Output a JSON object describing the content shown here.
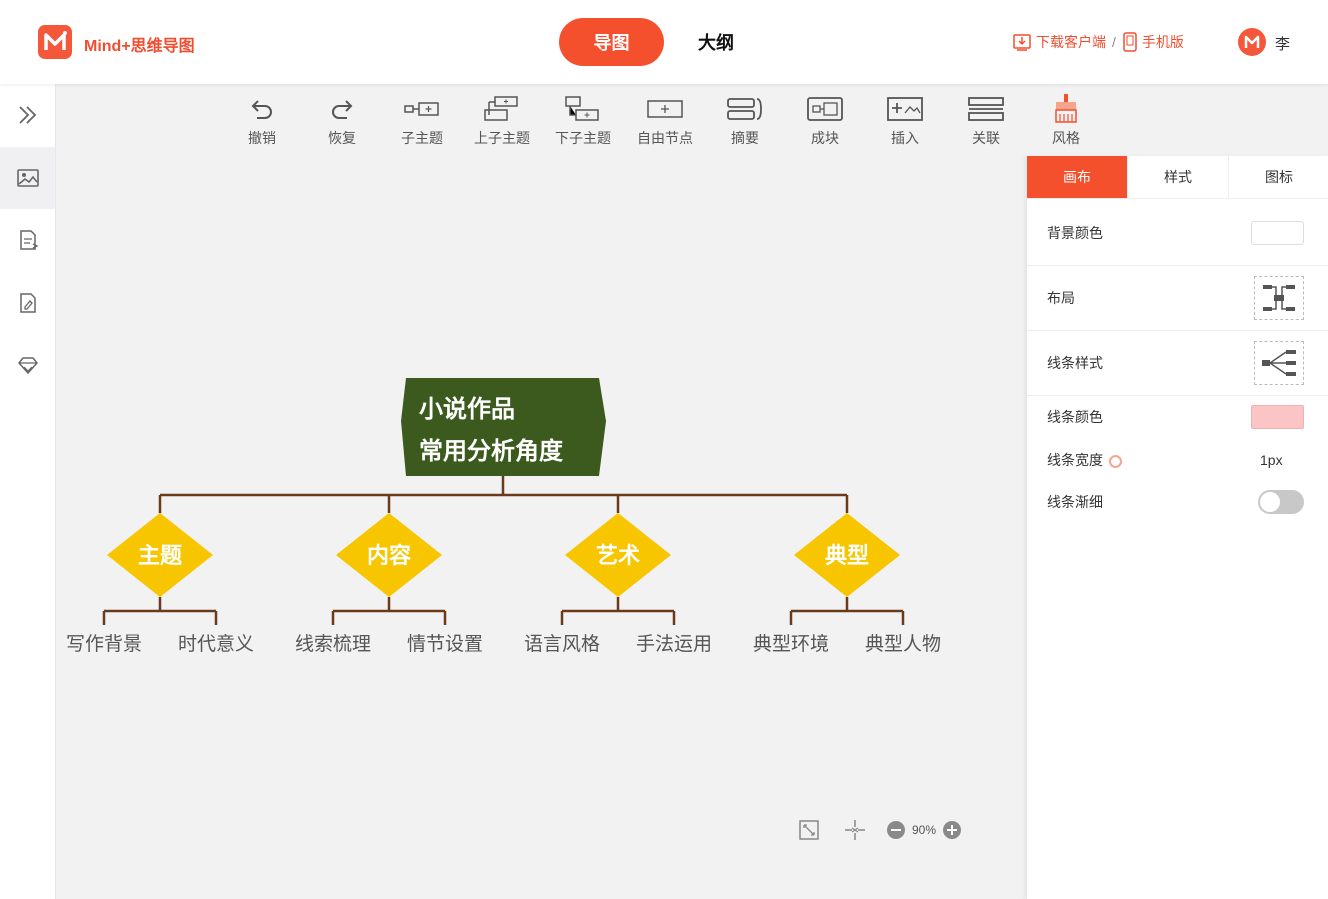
{
  "header": {
    "brand": "Mind+思维导图",
    "tabs": [
      {
        "label": "导图",
        "active": true
      },
      {
        "label": "大纲",
        "active": false
      }
    ],
    "download_client": "下载客户端",
    "separator": "/",
    "mobile": "手机版",
    "user": "李",
    "accent_color": "#f5502e"
  },
  "sidebar": {
    "items": [
      {
        "icon": "expand-chevrons-icon"
      },
      {
        "icon": "image-icon",
        "active": true
      },
      {
        "icon": "pdf-export-icon"
      },
      {
        "icon": "file-edit-icon"
      },
      {
        "icon": "diamond-icon"
      }
    ]
  },
  "toolbar": {
    "items": [
      {
        "label": "撤销",
        "icon": "undo-icon"
      },
      {
        "label": "恢复",
        "icon": "redo-icon"
      },
      {
        "label": "子主题",
        "icon": "child-topic-icon"
      },
      {
        "label": "上子主题",
        "icon": "upper-subtopic-icon"
      },
      {
        "label": "下子主题",
        "icon": "lower-subtopic-icon"
      },
      {
        "label": "自由节点",
        "icon": "free-node-icon"
      },
      {
        "label": "摘要",
        "icon": "summary-icon"
      },
      {
        "label": "成块",
        "icon": "block-icon"
      },
      {
        "label": "插入",
        "icon": "insert-icon"
      },
      {
        "label": "关联",
        "icon": "relation-icon"
      },
      {
        "label": "风格",
        "icon": "style-brush-icon"
      }
    ]
  },
  "mindmap": {
    "root": {
      "line1": "小说作品",
      "line2": "常用分析角度",
      "color": "#3c5a1e"
    },
    "topic_color": "#f7c600",
    "line_color": "#6b3a1a",
    "topics": [
      {
        "label": "主题",
        "children": [
          "写作背景",
          "时代意义"
        ]
      },
      {
        "label": "内容",
        "children": [
          "线索梳理",
          "情节设置"
        ]
      },
      {
        "label": "艺术",
        "children": [
          "语言风格",
          "手法运用"
        ]
      },
      {
        "label": "典型",
        "children": [
          "典型环境",
          "典型人物"
        ]
      }
    ]
  },
  "zoom": {
    "value": "90%"
  },
  "panel": {
    "tabs": [
      {
        "label": "画布",
        "active": true
      },
      {
        "label": "样式",
        "active": false
      },
      {
        "label": "图标",
        "active": false
      }
    ],
    "bg_color_label": "背景颜色",
    "bg_color": "#ffffff",
    "layout_label": "布局",
    "line_style_label": "线条样式",
    "line_color_label": "线条颜色",
    "line_color": "#fcc5c5",
    "line_width_label": "线条宽度",
    "line_width_value": "1px",
    "line_taper_label": "线条渐细",
    "line_taper_on": false
  }
}
